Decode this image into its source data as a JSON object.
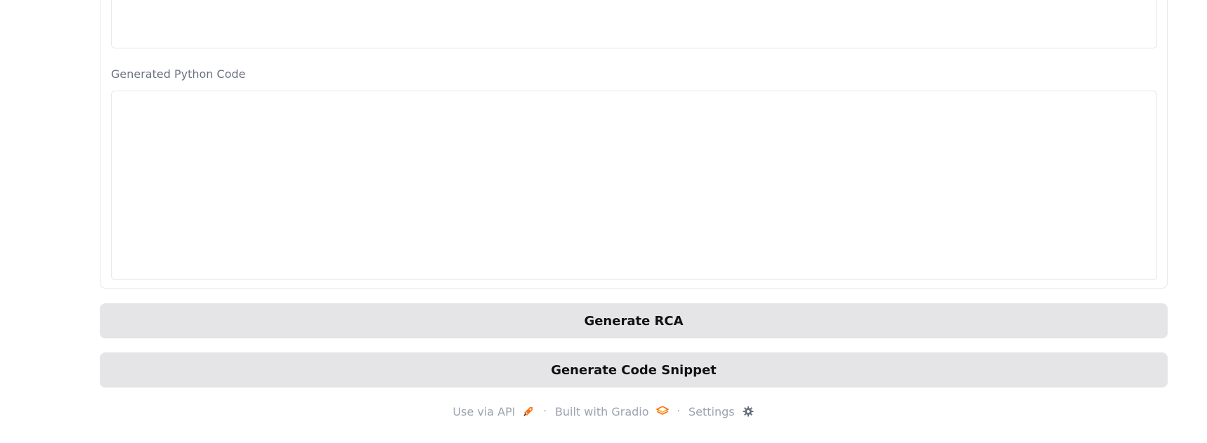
{
  "form": {
    "code_label": "Generated Python Code",
    "code_value": "",
    "top_textarea_value": ""
  },
  "buttons": {
    "generate_rca": "Generate RCA",
    "generate_snippet": "Generate Code Snippet"
  },
  "footer": {
    "api_link": "Use via API",
    "api_icon": "rocket-icon",
    "separator": "·",
    "gradio_link": "Built with Gradio",
    "gradio_icon": "gradio-logo-icon",
    "settings_link": "Settings",
    "settings_icon": "gear-icon"
  },
  "colors": {
    "button_bg": "#e5e5e7",
    "accent": "#f97316",
    "muted_text": "#9ca3af"
  }
}
